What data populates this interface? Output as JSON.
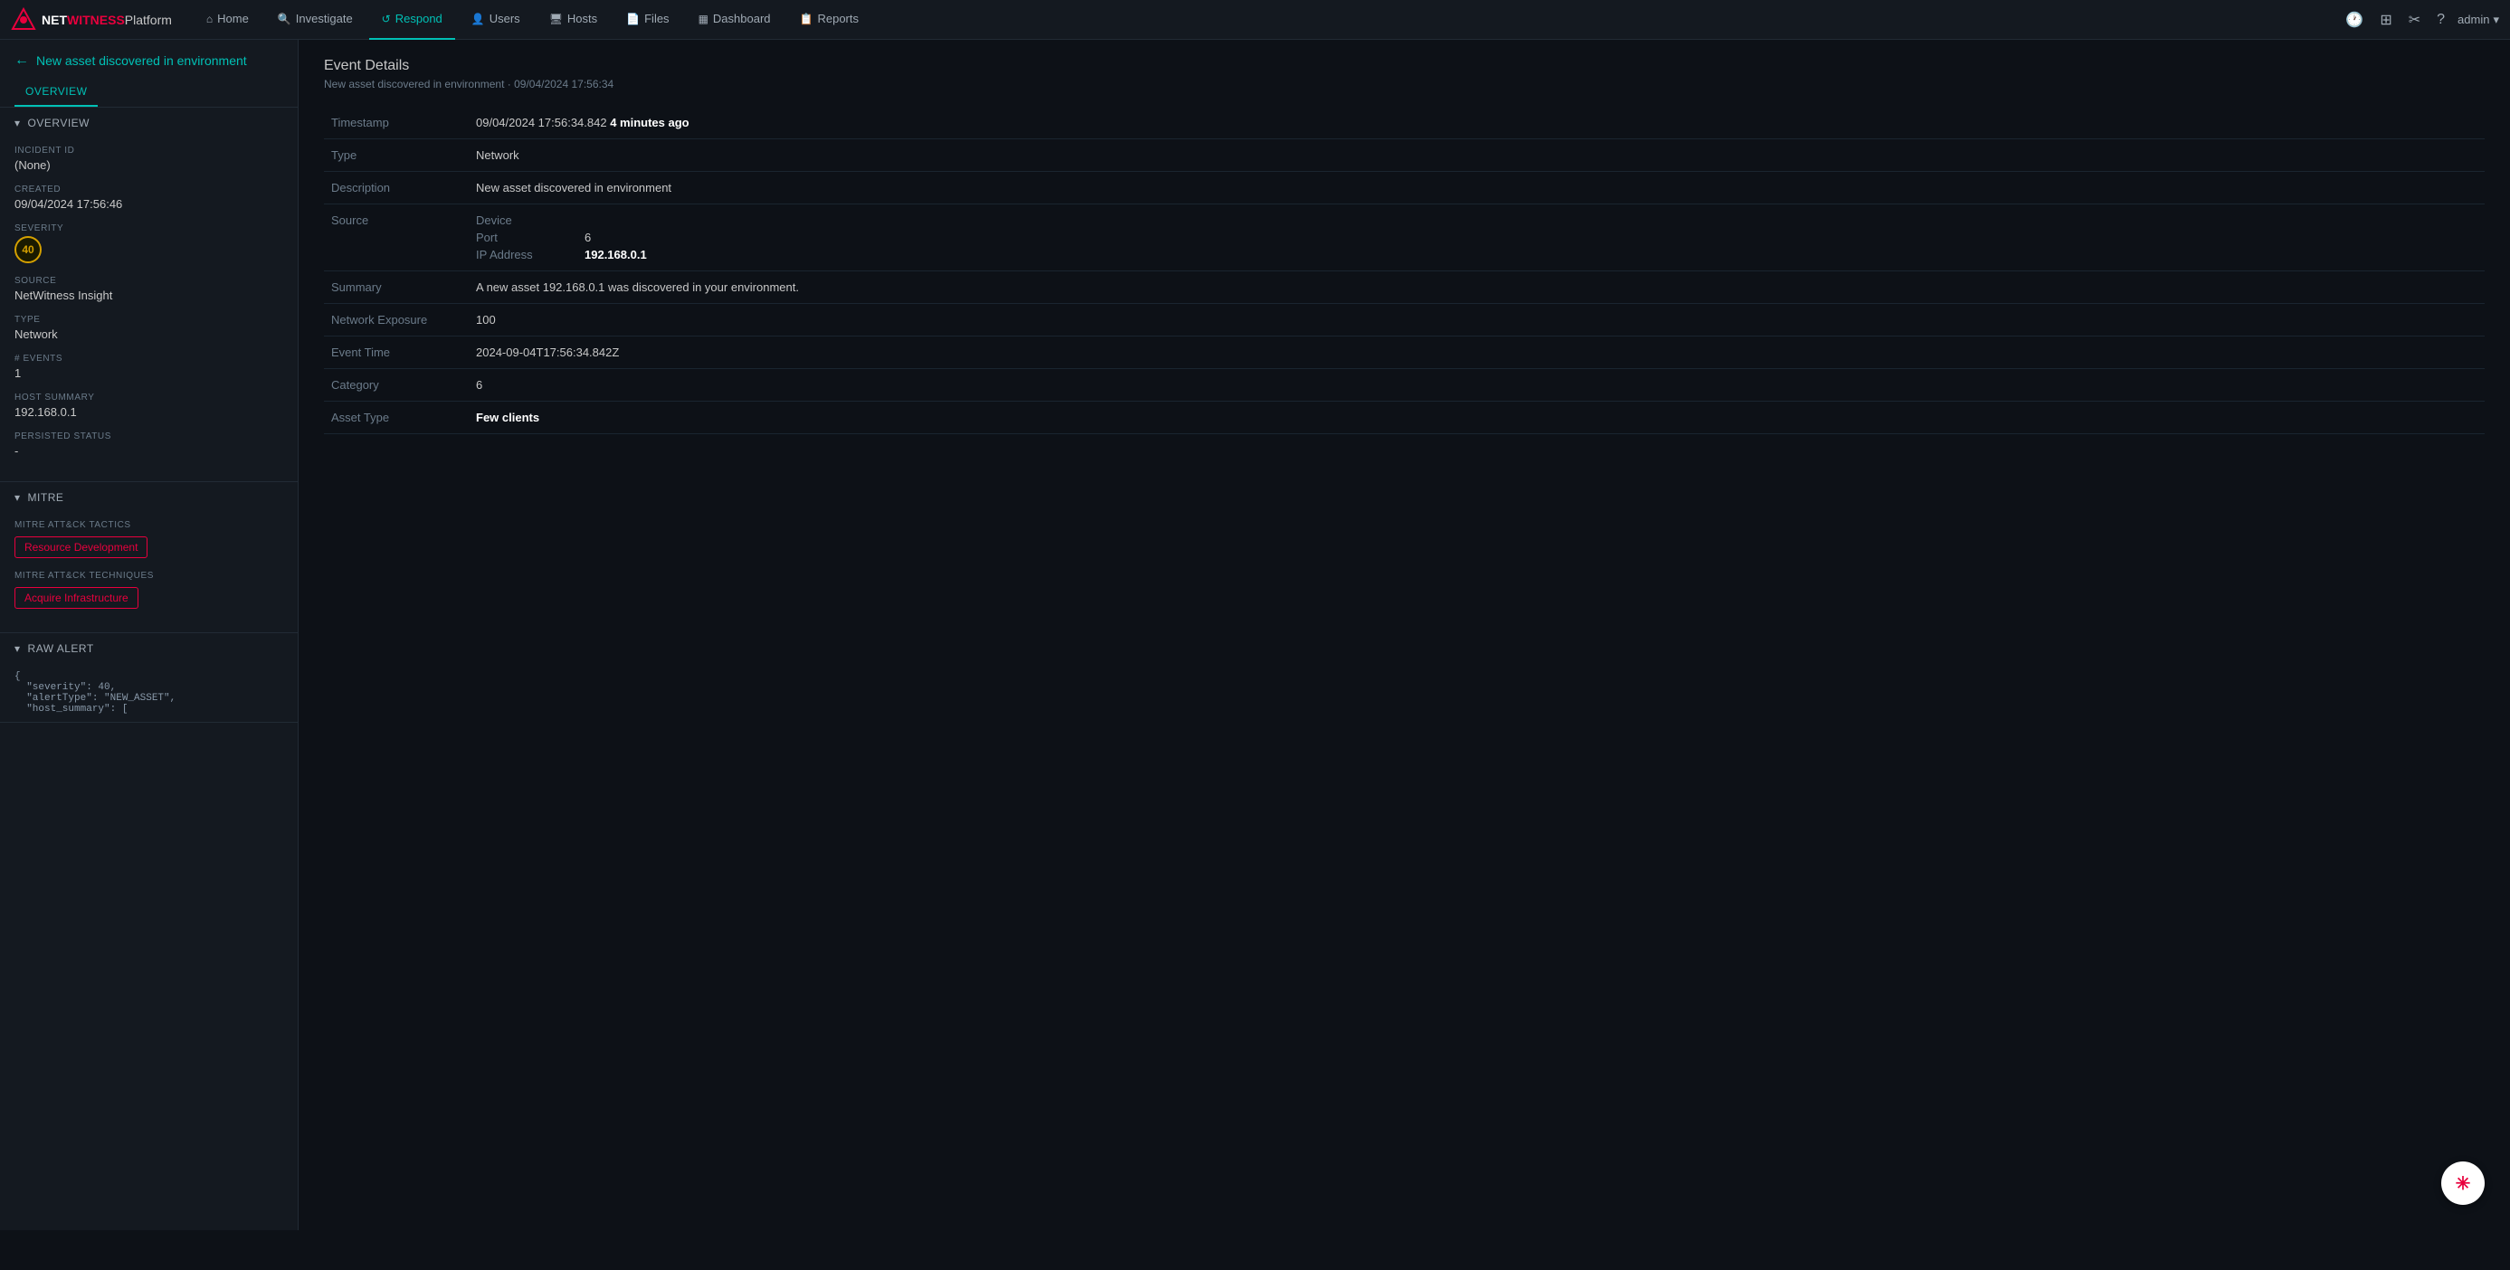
{
  "app": {
    "logo_net": "NET",
    "logo_witness": "WITNESS",
    "logo_platform": " Platform"
  },
  "topnav": {
    "links": [
      {
        "id": "home",
        "label": "Home",
        "icon": "⌂",
        "active": false
      },
      {
        "id": "investigate",
        "label": "Investigate",
        "icon": "🔍",
        "active": false
      },
      {
        "id": "respond",
        "label": "Respond",
        "icon": "↺",
        "active": true
      },
      {
        "id": "users",
        "label": "Users",
        "icon": "👤",
        "active": false
      },
      {
        "id": "hosts",
        "label": "Hosts",
        "icon": "🖥",
        "active": false
      },
      {
        "id": "files",
        "label": "Files",
        "icon": "📄",
        "active": false
      },
      {
        "id": "dashboard",
        "label": "Dashboard",
        "icon": "▦",
        "active": false
      },
      {
        "id": "reports",
        "label": "Reports",
        "icon": "📋",
        "active": false
      }
    ],
    "admin_label": "admin"
  },
  "sidebar": {
    "back_label": "New asset discovered in environment",
    "tab_overview": "OVERVIEW",
    "sections": {
      "overview": {
        "header": "OVERVIEW",
        "fields": {
          "incident_id_label": "INCIDENT ID",
          "incident_id_value": "(None)",
          "created_label": "CREATED",
          "created_value": "09/04/2024 17:56:46",
          "severity_label": "SEVERITY",
          "severity_value": "40",
          "source_label": "SOURCE",
          "source_value": "NetWitness Insight",
          "type_label": "TYPE",
          "type_value": "Network",
          "events_label": "# EVENTS",
          "events_value": "1",
          "host_summary_label": "HOST SUMMARY",
          "host_summary_value": "192.168.0.1",
          "persisted_status_label": "PERSISTED STATUS",
          "persisted_status_value": "-"
        }
      },
      "mitre": {
        "header": "MITRE",
        "tactics_label": "MITRE ATT&CK TACTICS",
        "tactics_tag": "Resource Development",
        "techniques_label": "MITRE ATT&CK TECHNIQUES",
        "techniques_tag": "Acquire Infrastructure"
      },
      "raw_alert": {
        "header": "RAW ALERT",
        "content": "{\n  \"severity\": 40,\n  \"alertType\": \"NEW_ASSET\",\n  \"host_summary\": ["
      }
    }
  },
  "main": {
    "event_details_title": "Event Details",
    "event_subtitle": "New asset discovered in environment · 09/04/2024 17:56:34",
    "fields": [
      {
        "label": "Timestamp",
        "value": "09/04/2024 17:56:34.842 ",
        "value_extra": "4 minutes ago",
        "type": "timestamp"
      },
      {
        "label": "Type",
        "value": "Network",
        "type": "plain"
      },
      {
        "label": "Description",
        "value": "New asset discovered in environment",
        "type": "plain"
      },
      {
        "label": "Source",
        "type": "nested",
        "nested": [
          {
            "label": "Device",
            "value": ""
          },
          {
            "label": "Port",
            "value": "6"
          },
          {
            "label": "IP Address",
            "value": "192.168.0.1",
            "bold": true
          }
        ]
      },
      {
        "label": "Summary",
        "value": "A new asset 192.168.0.1 was discovered in your environment.",
        "type": "plain"
      },
      {
        "label": "Network Exposure",
        "value": "100",
        "type": "plain"
      },
      {
        "label": "Event Time",
        "value": "2024-09-04T17:56:34.842Z",
        "type": "plain"
      },
      {
        "label": "Category",
        "value": "6",
        "type": "plain"
      },
      {
        "label": "Asset Type",
        "value": "Few clients",
        "type": "bold"
      }
    ]
  }
}
